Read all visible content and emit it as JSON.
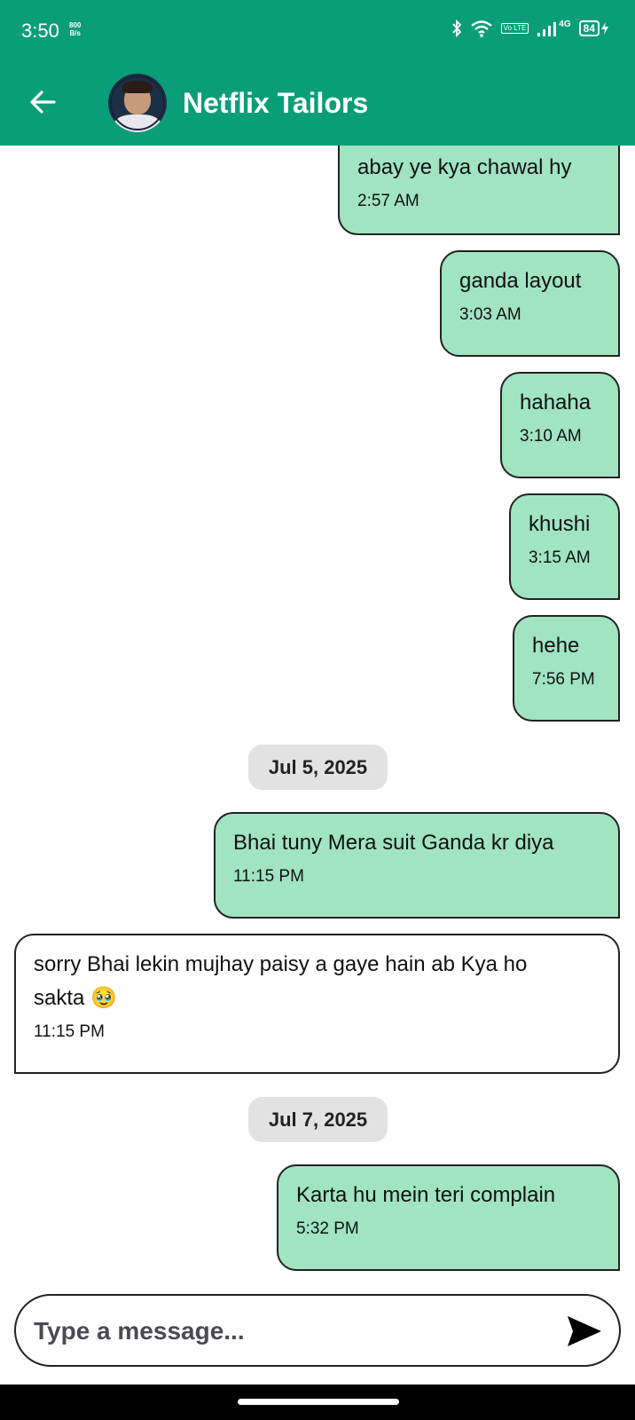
{
  "status_bar": {
    "time": "3:50",
    "net_speed_value": "800",
    "net_speed_unit": "B/s",
    "network": "4G",
    "battery": "84",
    "volte": "Vo LTE"
  },
  "header": {
    "title": "Netflix Tailors"
  },
  "messages": [
    {
      "text": "abay ye kya chawal hy",
      "time": "2:57 AM",
      "direction": "out"
    },
    {
      "text": "ganda layout",
      "time": "3:03 AM",
      "direction": "out"
    },
    {
      "text": "hahaha",
      "time": "3:10 AM",
      "direction": "out"
    },
    {
      "text": "khushi",
      "time": "3:15 AM",
      "direction": "out"
    },
    {
      "text": "hehe",
      "time": "7:56 PM",
      "direction": "out"
    },
    {
      "text": "Bhai tuny Mera suit Ganda kr diya",
      "time": "11:15 PM",
      "direction": "out"
    },
    {
      "text_line1": "sorry Bhai lekin mujhay paisy a gaye hain ab Kya ho",
      "text_line2": "sakta 🥹",
      "time": "11:15 PM",
      "direction": "in"
    },
    {
      "text": "Karta hu mein teri complain",
      "time": "5:32 PM",
      "direction": "out"
    }
  ],
  "date_separators": [
    "Jul 5, 2025",
    "Jul 7, 2025"
  ],
  "composer": {
    "placeholder": "Type a message..."
  },
  "colors": {
    "brand": "#0a9e78",
    "outgoing_bubble": "#a0e4c1",
    "incoming_bubble": "#ffffff",
    "date_chip": "#e2e2e2"
  },
  "icons": [
    "back-arrow-icon",
    "avatar",
    "send-icon",
    "bluetooth-icon",
    "wifi-icon",
    "signal-icon",
    "battery-icon",
    "charging-icon"
  ]
}
